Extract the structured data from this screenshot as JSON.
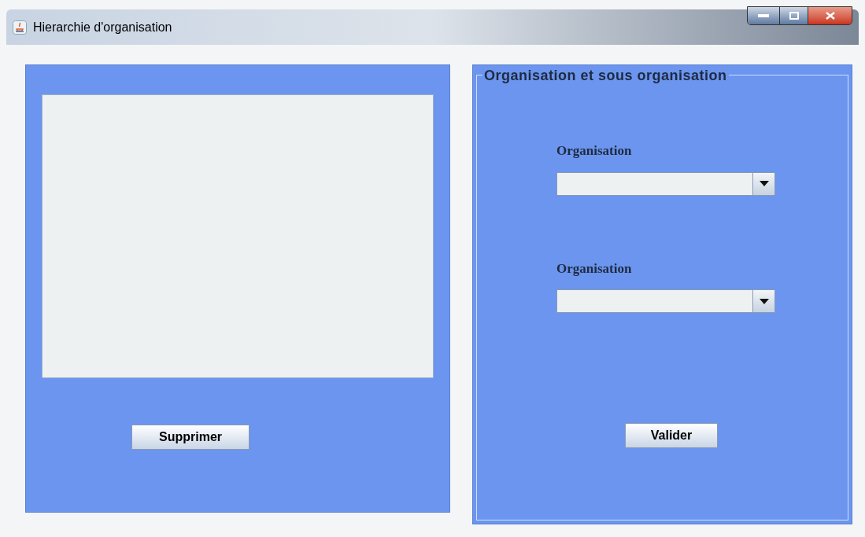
{
  "window": {
    "title": "Hierarchie d'organisation"
  },
  "left_panel": {
    "button": "Supprimer"
  },
  "right_panel": {
    "title": "Organisation et sous organisation",
    "fields": [
      {
        "label": "Organisation"
      },
      {
        "label": "Organisation"
      }
    ],
    "button": "Valider"
  }
}
